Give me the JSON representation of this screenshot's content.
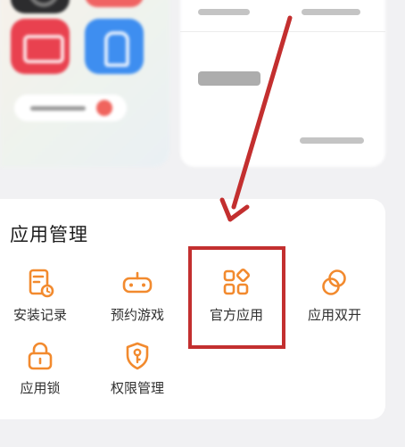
{
  "section": {
    "title": "应用管理"
  },
  "items": [
    {
      "label": "安装记录",
      "icon": "install-record-icon"
    },
    {
      "label": "预约游戏",
      "icon": "gamepad-icon"
    },
    {
      "label": "官方应用",
      "icon": "apps-grid-icon"
    },
    {
      "label": "应用双开",
      "icon": "dual-app-icon"
    },
    {
      "label": "应用锁",
      "icon": "lock-icon"
    },
    {
      "label": "权限管理",
      "icon": "shield-key-icon"
    }
  ],
  "colors": {
    "accent": "#f28a2e",
    "annotation": "#c32f2f"
  }
}
